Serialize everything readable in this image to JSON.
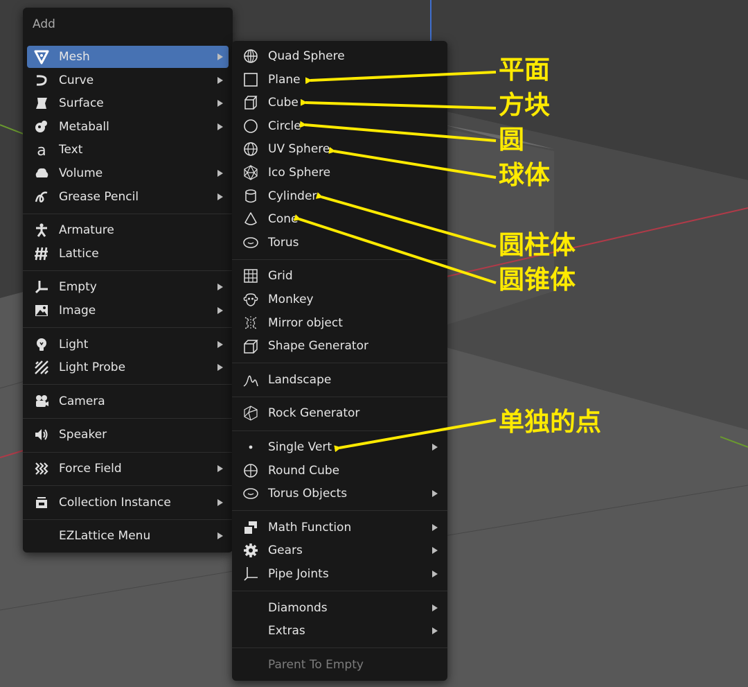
{
  "add_menu": {
    "title": "Add",
    "items": [
      {
        "label": "Mesh",
        "icon": "mesh-icon",
        "submenu": true,
        "active": true
      },
      {
        "label": "Curve",
        "icon": "curve-icon",
        "submenu": true
      },
      {
        "label": "Surface",
        "icon": "surface-icon",
        "submenu": true
      },
      {
        "label": "Metaball",
        "icon": "metaball-icon",
        "submenu": true
      },
      {
        "label": "Text",
        "icon": "text-icon",
        "submenu": false
      },
      {
        "label": "Volume",
        "icon": "volume-icon",
        "submenu": true
      },
      {
        "label": "Grease Pencil",
        "icon": "grease-pencil-icon",
        "submenu": true
      },
      {
        "label": "Armature",
        "icon": "armature-icon",
        "submenu": false
      },
      {
        "label": "Lattice",
        "icon": "lattice-icon",
        "submenu": false
      },
      {
        "label": "Empty",
        "icon": "empty-icon",
        "submenu": true
      },
      {
        "label": "Image",
        "icon": "image-icon",
        "submenu": true
      },
      {
        "label": "Light",
        "icon": "light-icon",
        "submenu": true
      },
      {
        "label": "Light Probe",
        "icon": "light-probe-icon",
        "submenu": true
      },
      {
        "label": "Camera",
        "icon": "camera-icon",
        "submenu": false
      },
      {
        "label": "Speaker",
        "icon": "speaker-icon",
        "submenu": false
      },
      {
        "label": "Force Field",
        "icon": "force-field-icon",
        "submenu": true
      },
      {
        "label": "Collection Instance",
        "icon": "collection-icon",
        "submenu": true
      },
      {
        "label": "EZLattice Menu",
        "icon": "",
        "submenu": true
      }
    ]
  },
  "mesh_menu": {
    "items": [
      {
        "label": "Quad Sphere",
        "icon": "quad-sphere-icon",
        "submenu": false
      },
      {
        "label": "Plane",
        "icon": "plane-icon",
        "submenu": false
      },
      {
        "label": "Cube",
        "icon": "cube-icon",
        "submenu": false
      },
      {
        "label": "Circle",
        "icon": "circle-icon",
        "submenu": false
      },
      {
        "label": "UV Sphere",
        "icon": "uv-sphere-icon",
        "submenu": false
      },
      {
        "label": "Ico Sphere",
        "icon": "ico-sphere-icon",
        "submenu": false
      },
      {
        "label": "Cylinder",
        "icon": "cylinder-icon",
        "submenu": false
      },
      {
        "label": "Cone",
        "icon": "cone-icon",
        "submenu": false
      },
      {
        "label": "Torus",
        "icon": "torus-icon",
        "submenu": false
      },
      {
        "label": "Grid",
        "icon": "grid-icon",
        "submenu": false
      },
      {
        "label": "Monkey",
        "icon": "monkey-icon",
        "submenu": false
      },
      {
        "label": "Mirror object",
        "icon": "mirror-object-icon",
        "submenu": false
      },
      {
        "label": "Shape Generator",
        "icon": "shape-generator-icon",
        "submenu": false
      },
      {
        "label": "Landscape",
        "icon": "landscape-icon",
        "submenu": false
      },
      {
        "label": "Rock Generator",
        "icon": "rock-generator-icon",
        "submenu": false
      },
      {
        "label": "Single Vert",
        "icon": "single-vert-icon",
        "submenu": true
      },
      {
        "label": "Round Cube",
        "icon": "round-cube-icon",
        "submenu": false
      },
      {
        "label": "Torus Objects",
        "icon": "torus-objects-icon",
        "submenu": true
      },
      {
        "label": "Math Function",
        "icon": "math-function-icon",
        "submenu": true
      },
      {
        "label": "Gears",
        "icon": "gears-icon",
        "submenu": true
      },
      {
        "label": "Pipe Joints",
        "icon": "pipe-joints-icon",
        "submenu": true
      },
      {
        "label": "Diamonds",
        "icon": "",
        "submenu": true
      },
      {
        "label": "Extras",
        "icon": "",
        "submenu": true
      },
      {
        "label": "Parent To Empty",
        "icon": "",
        "submenu": false,
        "disabled": true
      }
    ]
  },
  "annotations": [
    {
      "text": "平面"
    },
    {
      "text": "方块"
    },
    {
      "text": "圆"
    },
    {
      "text": "球体"
    },
    {
      "text": "圆柱体"
    },
    {
      "text": "圆锥体"
    },
    {
      "text": "单独的点"
    }
  ],
  "colors": {
    "menu_bg": "#181818",
    "highlight": "#4772b3",
    "annotation": "#ffea00",
    "viewport_bg": "#3d3d3d",
    "x_axis": "#b03a48",
    "y_axis": "#6a9a2e",
    "z_axis": "#3f6fcf"
  }
}
